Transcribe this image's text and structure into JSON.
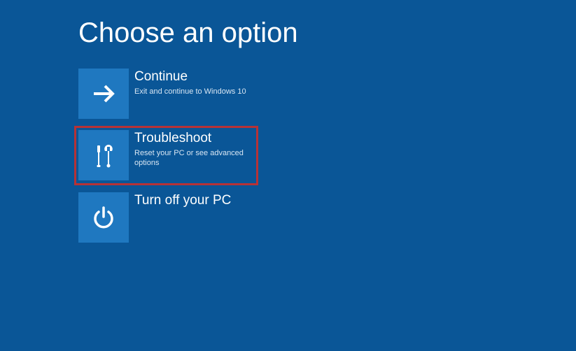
{
  "page": {
    "title": "Choose an option"
  },
  "options": {
    "continue": {
      "title": "Continue",
      "desc": "Exit and continue to Windows 10"
    },
    "troubleshoot": {
      "title": "Troubleshoot",
      "desc": "Reset your PC or see advanced options"
    },
    "turnoff": {
      "title": "Turn off your PC",
      "desc": ""
    }
  },
  "colors": {
    "background": "#0a5697",
    "tile": "#1f78c0",
    "highlight": "#b73236"
  }
}
